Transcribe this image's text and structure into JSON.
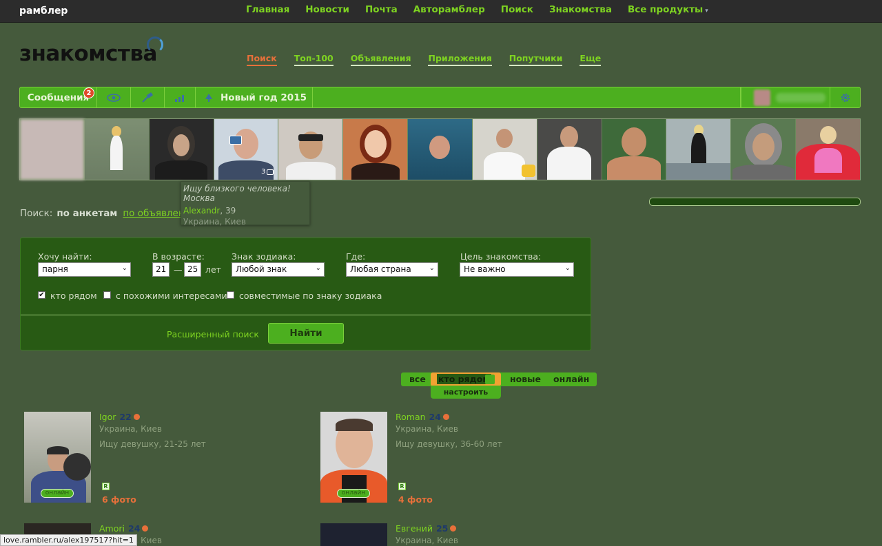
{
  "topbar": {
    "brand": "рамблер",
    "links": [
      "Главная",
      "Новости",
      "Почта",
      "Авторамблер",
      "Поиск",
      "Знакомства",
      "Все продукты"
    ]
  },
  "logo": {
    "text": "знакомства"
  },
  "secnav": [
    "Поиск",
    "Топ-100",
    "Объявления",
    "Приложения",
    "Попутчики",
    "Еще"
  ],
  "toolbar": {
    "messages_label": "Сообщения",
    "messages_count": "2",
    "holiday_label": "Новый год 2015",
    "icons": [
      "eye-icon",
      "satellite-icon",
      "stats-icon",
      "tree-icon",
      "gear-icon"
    ]
  },
  "tooltip": {
    "text": "Ищу близкого человека! Москва",
    "name": "Alexandr",
    "age": ", 39",
    "location": "Украина, Киев",
    "photo_count": "3"
  },
  "search": {
    "label": "Поиск:",
    "by_profiles": "по анкетам",
    "by_ads": "по объявлениям"
  },
  "panel": {
    "want_label": "Хочу найти:",
    "want_value": "парня",
    "age_label": "В возрасте:",
    "age_from": "21",
    "age_sep": "—",
    "age_to": "25",
    "age_unit": "лет",
    "zodiac_label": "Знак зодиака:",
    "zodiac_value": "Любой знак",
    "where_label": "Где:",
    "where_value": "Любая страна",
    "goal_label": "Цель знакомства:",
    "goal_value": "Не важно",
    "cb_near": "кто рядом",
    "cb_near_checked": true,
    "cb_interests": "с похожими интересами",
    "cb_zodiac": "совместимые по знаку зодиака",
    "advanced": "Расширенный поиск",
    "find": "Найти"
  },
  "filters": {
    "all": "все",
    "near": "кто рядом",
    "new": "новые",
    "online": "онлайн",
    "tune": "настроить"
  },
  "results": [
    {
      "name": "Igor",
      "age": "22",
      "location": "Украина, Киев",
      "seek": "Ищу девушку, 21-25 лет",
      "online": "онлайн",
      "photos": "6 фото"
    },
    {
      "name": "Roman",
      "age": "24",
      "location": "Украина, Киев",
      "seek": "Ищу девушку, 36-60 лет",
      "online": "онлайн",
      "photos": "4 фото"
    },
    {
      "name": "Amori",
      "age": "24",
      "location": "Украина, Киев"
    },
    {
      "name": "Евгений",
      "age": "25",
      "location": "Украина, Киев"
    }
  ],
  "statusbar": "love.rambler.ru/alex197517?hit=1"
}
